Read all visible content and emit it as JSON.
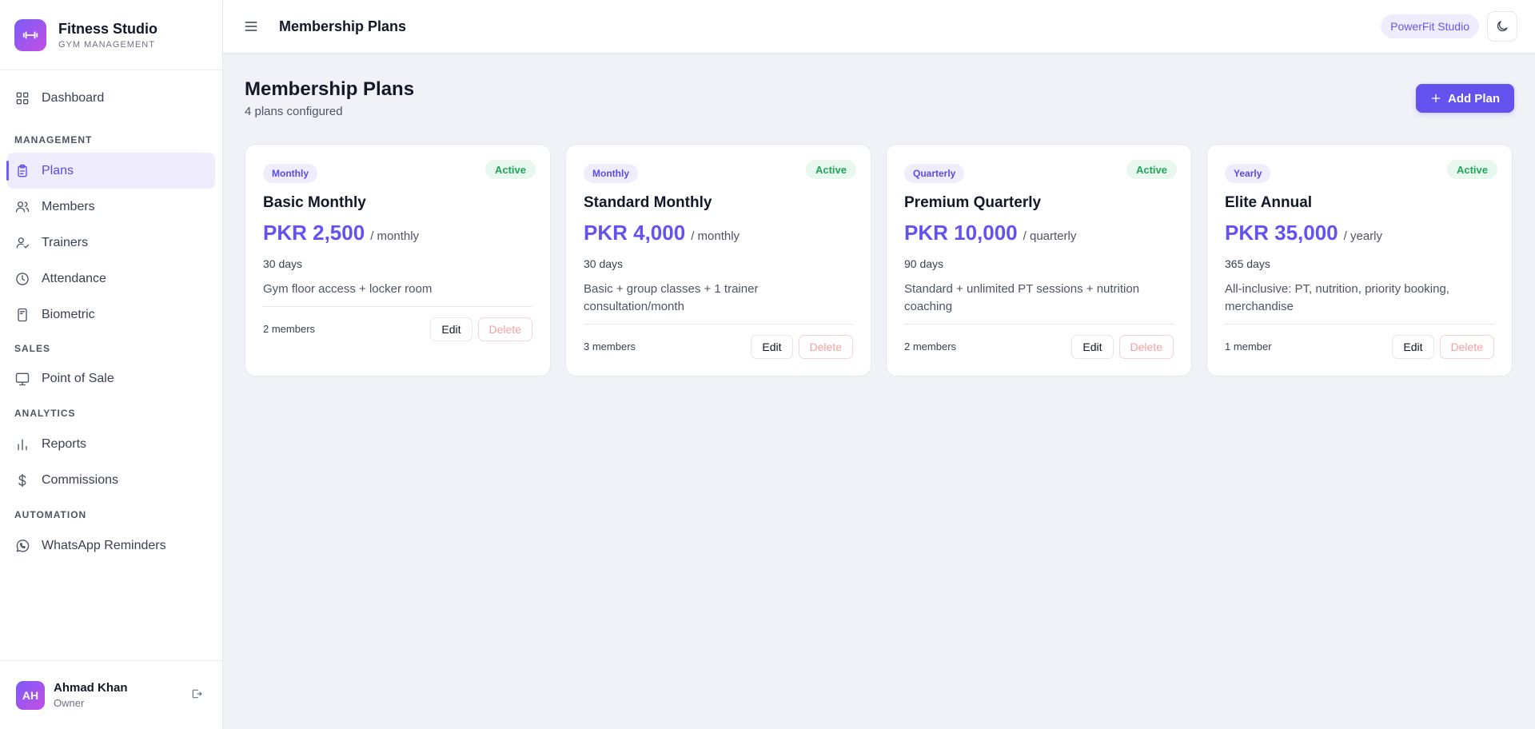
{
  "brand": {
    "title": "Fitness Studio",
    "subtitle": "GYM MANAGEMENT"
  },
  "nav": {
    "dashboard": "Dashboard",
    "section_management": "MANAGEMENT",
    "plans": "Plans",
    "members": "Members",
    "trainers": "Trainers",
    "attendance": "Attendance",
    "biometric": "Biometric",
    "section_sales": "SALES",
    "pos": "Point of Sale",
    "section_analytics": "ANALYTICS",
    "reports": "Reports",
    "commissions": "Commissions",
    "section_automation": "AUTOMATION",
    "whatsapp": "WhatsApp Reminders"
  },
  "user": {
    "initials": "AH",
    "name": "Ahmad Khan",
    "role": "Owner"
  },
  "topbar": {
    "title": "Membership Plans",
    "studio": "PowerFit Studio"
  },
  "page": {
    "title": "Membership Plans",
    "subtitle": "4 plans configured",
    "add_label": "Add Plan"
  },
  "plans": [
    {
      "type": "Monthly",
      "status": "Active",
      "name": "Basic Monthly",
      "price": "PKR 2,500",
      "period": "/ monthly",
      "days": "30 days",
      "description": "Gym floor access + locker room",
      "members": "2 members",
      "edit": "Edit",
      "delete": "Delete"
    },
    {
      "type": "Monthly",
      "status": "Active",
      "name": "Standard Monthly",
      "price": "PKR 4,000",
      "period": "/ monthly",
      "days": "30 days",
      "description": "Basic + group classes + 1 trainer consultation/month",
      "members": "3 members",
      "edit": "Edit",
      "delete": "Delete"
    },
    {
      "type": "Quarterly",
      "status": "Active",
      "name": "Premium Quarterly",
      "price": "PKR 10,000",
      "period": "/ quarterly",
      "days": "90 days",
      "description": "Standard + unlimited PT sessions + nutrition coaching",
      "members": "2 members",
      "edit": "Edit",
      "delete": "Delete"
    },
    {
      "type": "Yearly",
      "status": "Active",
      "name": "Elite Annual",
      "price": "PKR 35,000",
      "period": "/ yearly",
      "days": "365 days",
      "description": "All-inclusive: PT, nutrition, priority booking, merchandise",
      "members": "1 member",
      "edit": "Edit",
      "delete": "Delete"
    }
  ],
  "colors": {
    "accent": "#6452ef",
    "active_bg": "#efedfd",
    "status_green": "#22a55a",
    "page_bg": "#f1f2f7"
  }
}
